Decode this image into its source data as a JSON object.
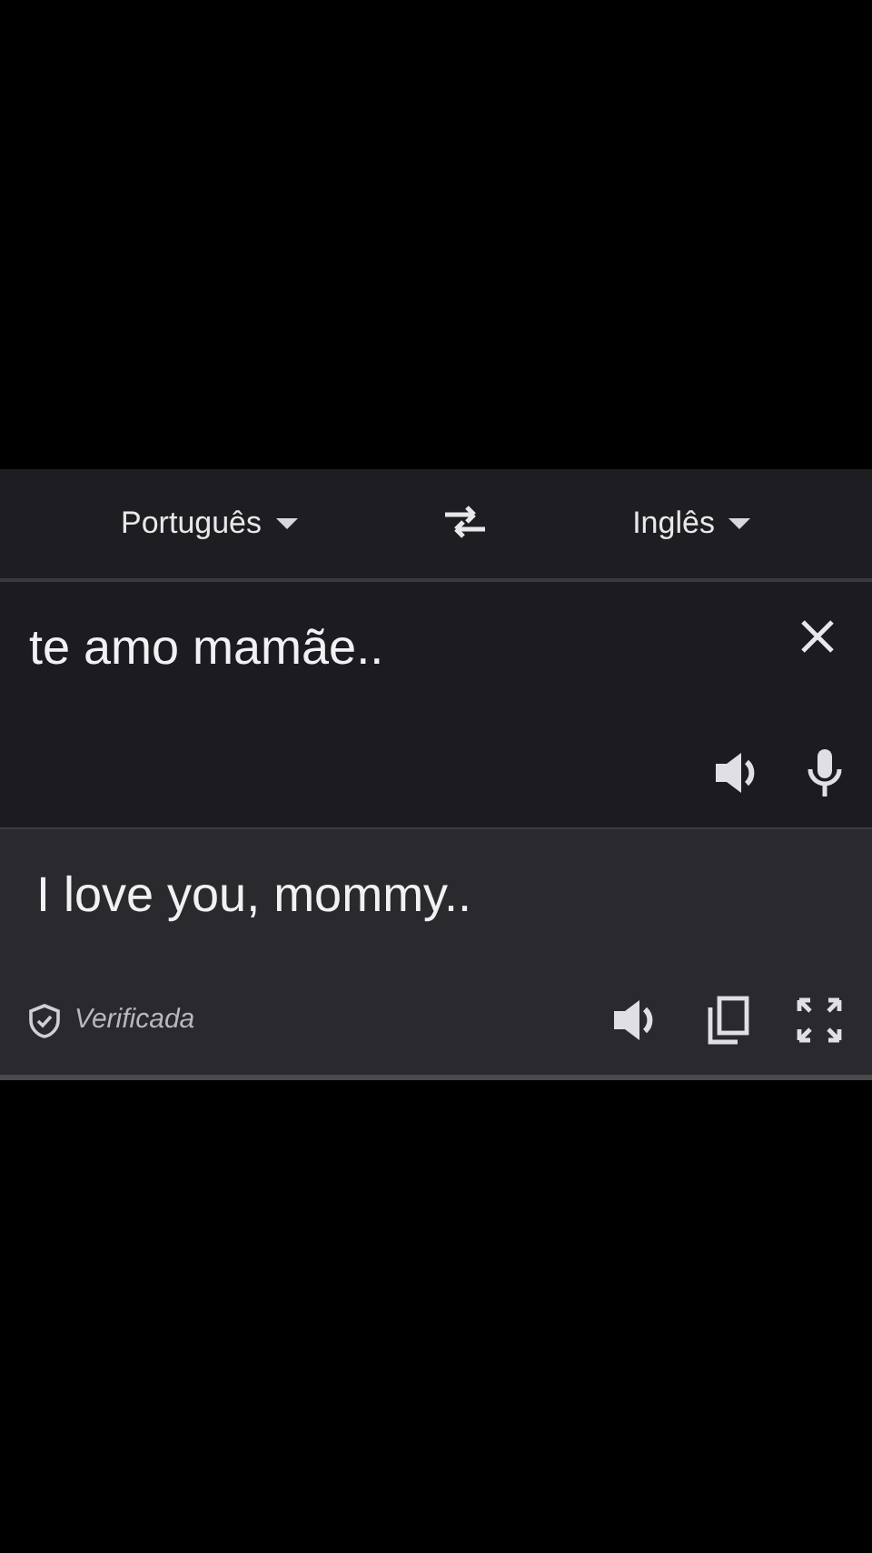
{
  "languages": {
    "source": "Português",
    "target": "Inglês"
  },
  "input": {
    "text": "te amo mamãe.."
  },
  "output": {
    "text": "I love you, mommy..",
    "badge": "Verificada"
  }
}
